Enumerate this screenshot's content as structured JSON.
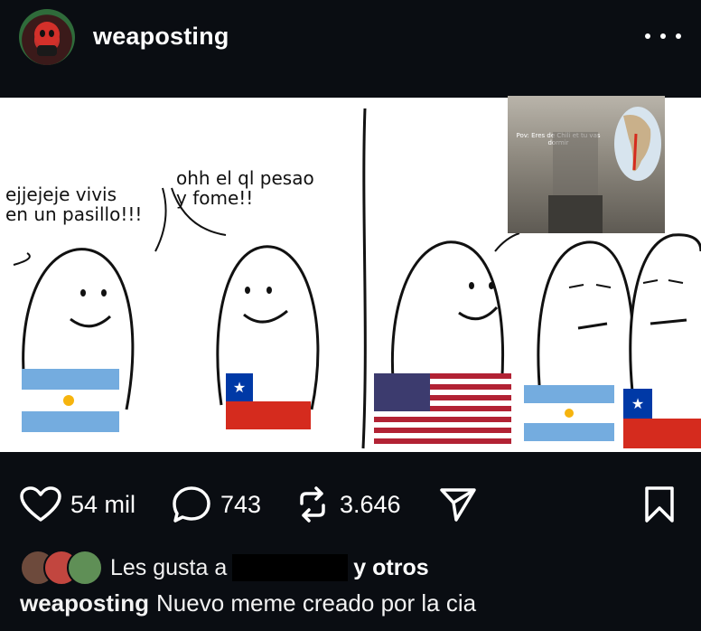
{
  "header": {
    "username": "weaposting",
    "avatar_icon": "profile-avatar",
    "more_icon": "more-dots-icon"
  },
  "post": {
    "bubbles": [
      "ejjejeje vivis\nen un pasillo!!!",
      "ohh el ql pesao\ny fome!!"
    ],
    "inset_caption": "Pov: Eres de Chili et tu vas dormir",
    "colors": {
      "argentina_blue": "#74acdf",
      "chile_red": "#d52b1e",
      "chile_blue": "#0039a6",
      "usa_red": "#b22234",
      "usa_blue": "#3c3b6e"
    }
  },
  "actions": {
    "likes": "54 mil",
    "comments": "743",
    "reposts": "3.646"
  },
  "liked_by": {
    "prefix": "Les gusta a",
    "suffix": "y otros"
  },
  "caption": {
    "username": "weaposting",
    "text": "Nuevo meme creado por la cia"
  }
}
